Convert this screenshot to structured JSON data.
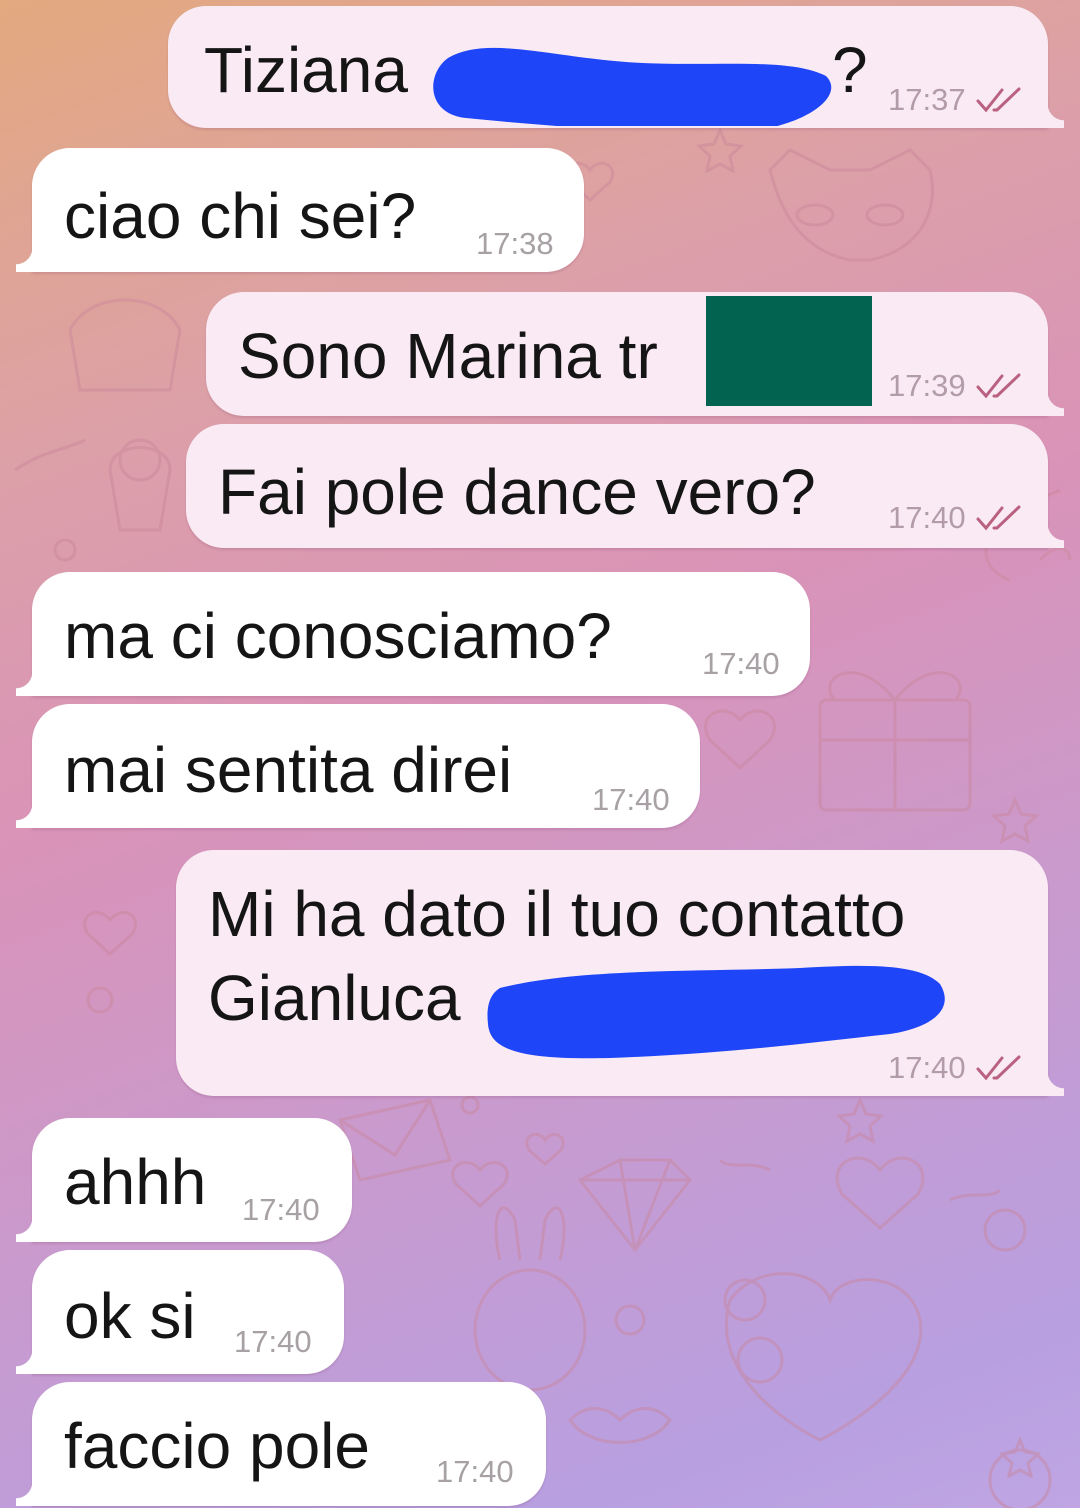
{
  "colors": {
    "incoming_bubble": "#ffffff",
    "outgoing_bubble": "#f9eaf3",
    "read_ticks": "#b9617f",
    "redaction_blue": "#1e45f7",
    "redaction_green": "#016350"
  },
  "icons": {
    "read_status": "double-check-icon"
  },
  "messages": [
    {
      "direction": "out",
      "lines": [
        "Tiziana",
        "?"
      ],
      "time": "17:37",
      "read": true
    },
    {
      "direction": "in",
      "lines": [
        "ciao chi sei?"
      ],
      "time": "17:38"
    },
    {
      "direction": "out",
      "lines": [
        "Sono Marina tr"
      ],
      "time": "17:39",
      "read": true
    },
    {
      "direction": "out",
      "lines": [
        "Fai pole dance vero?"
      ],
      "time": "17:40",
      "read": true
    },
    {
      "direction": "in",
      "lines": [
        "ma ci conosciamo?"
      ],
      "time": "17:40"
    },
    {
      "direction": "in",
      "lines": [
        "mai sentita direi"
      ],
      "time": "17:40"
    },
    {
      "direction": "out",
      "lines": [
        "Mi ha dato il tuo contatto",
        "Gianluca"
      ],
      "time": "17:40",
      "read": true
    },
    {
      "direction": "in",
      "lines": [
        "ahhh"
      ],
      "time": "17:40"
    },
    {
      "direction": "in",
      "lines": [
        "ok si"
      ],
      "time": "17:40"
    },
    {
      "direction": "in",
      "lines": [
        "faccio pole"
      ],
      "time": "17:40"
    }
  ]
}
